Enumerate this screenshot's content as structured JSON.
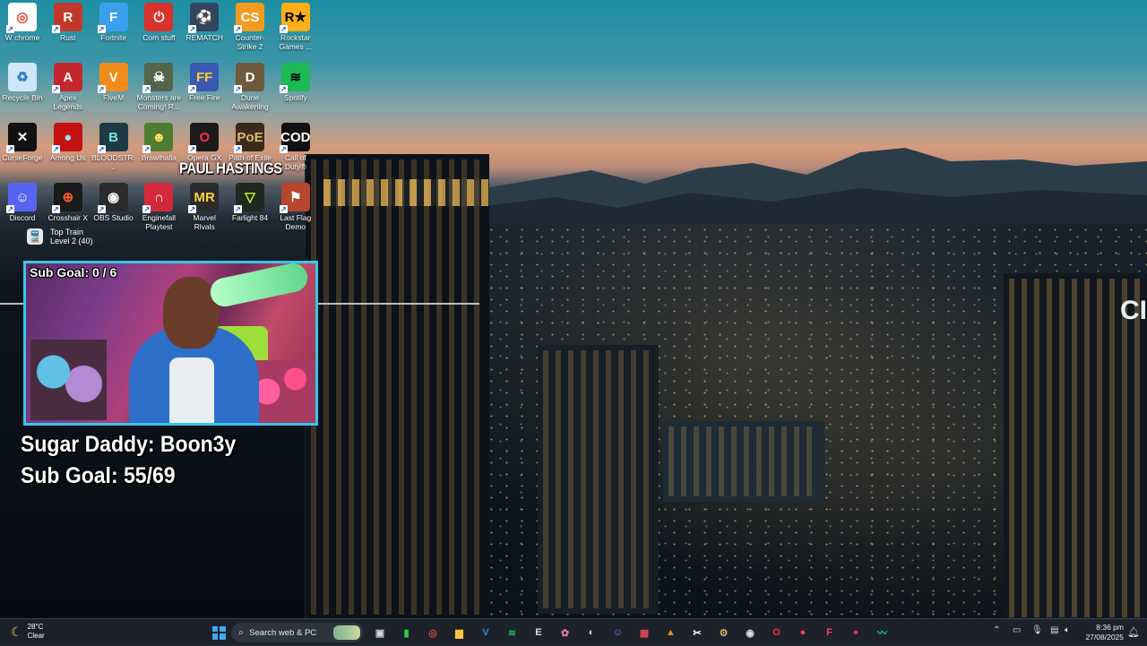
{
  "desktop_icons": [
    {
      "label": "W chrome",
      "glyph": "◎",
      "bg": "#ffffff",
      "fg": "#db4437",
      "col": 0,
      "row": 0
    },
    {
      "label": "Rust",
      "glyph": "R",
      "bg": "#c2392b",
      "fg": "#ffffff",
      "col": 1,
      "row": 0
    },
    {
      "label": "Fortnite",
      "glyph": "F",
      "bg": "#3aa0ee",
      "fg": "#ffffff",
      "col": 2,
      "row": 0
    },
    {
      "label": "Com stuff",
      "glyph": "⏻",
      "bg": "#d9322b",
      "fg": "#ffffff",
      "col": 3,
      "row": 0
    },
    {
      "label": "REMATCH",
      "glyph": "⚽",
      "bg": "#31465c",
      "fg": "#ffffff",
      "col": 4,
      "row": 0
    },
    {
      "label": "Counter-Strike 2",
      "glyph": "CS",
      "bg": "#f29b21",
      "fg": "#ffffff",
      "col": 5,
      "row": 0
    },
    {
      "label": "Rockstar Games ...",
      "glyph": "R★",
      "bg": "#fcaf17",
      "fg": "#000000",
      "col": 6,
      "row": 0
    },
    {
      "label": "Recycle Bin",
      "glyph": "♻",
      "bg": "#cfe6f7",
      "fg": "#2b7bc4",
      "col": 0,
      "row": 1
    },
    {
      "label": "Apex Legends",
      "glyph": "A",
      "bg": "#c4272d",
      "fg": "#ffffff",
      "col": 1,
      "row": 1
    },
    {
      "label": "FiveM",
      "glyph": "V",
      "bg": "#f08c1a",
      "fg": "#ffffff",
      "col": 2,
      "row": 1
    },
    {
      "label": "Monsters are Coming! R...",
      "glyph": "☠",
      "bg": "#54644a",
      "fg": "#ffffff",
      "col": 3,
      "row": 1
    },
    {
      "label": "Free Fire",
      "glyph": "FF",
      "bg": "#3a59b0",
      "fg": "#ffcc33",
      "col": 4,
      "row": 1
    },
    {
      "label": "Dune Awakening",
      "glyph": "D",
      "bg": "#6e5a3c",
      "fg": "#ffffff",
      "col": 5,
      "row": 1
    },
    {
      "label": "Spotify",
      "glyph": "≋",
      "bg": "#1db954",
      "fg": "#000000",
      "col": 6,
      "row": 1
    },
    {
      "label": "CurseForge",
      "glyph": "✕",
      "bg": "#121212",
      "fg": "#ffffff",
      "col": 0,
      "row": 2
    },
    {
      "label": "Among Us",
      "glyph": "●",
      "bg": "#c51111",
      "fg": "#9ddcf0",
      "col": 1,
      "row": 2
    },
    {
      "label": "BLOODSTR...",
      "glyph": "B",
      "bg": "#1d3b44",
      "fg": "#7fe0e0",
      "col": 2,
      "row": 2
    },
    {
      "label": "Brawlhalla",
      "glyph": "☻",
      "bg": "#4f7d2f",
      "fg": "#ffe25a",
      "col": 3,
      "row": 2
    },
    {
      "label": "Opera GX",
      "glyph": "O",
      "bg": "#1b1b1b",
      "fg": "#ff2b4a",
      "col": 4,
      "row": 2
    },
    {
      "label": "Path of Exile 2",
      "glyph": "PoE",
      "bg": "#3a2a1c",
      "fg": "#e3b873",
      "col": 5,
      "row": 2
    },
    {
      "label": "Call of Duty®",
      "glyph": "COD",
      "bg": "#111111",
      "fg": "#ffffff",
      "col": 6,
      "row": 2
    },
    {
      "label": "Discord",
      "glyph": "☺",
      "bg": "#5865f2",
      "fg": "#ffffff",
      "col": 0,
      "row": 3
    },
    {
      "label": "Crosshair X",
      "glyph": "⊕",
      "bg": "#1a1a1a",
      "fg": "#ff5a2a",
      "col": 1,
      "row": 3
    },
    {
      "label": "OBS Studio",
      "glyph": "◉",
      "bg": "#2b2b2b",
      "fg": "#ffffff",
      "col": 2,
      "row": 3
    },
    {
      "label": "Enginefall Playtest",
      "glyph": "∩",
      "bg": "#d22a3a",
      "fg": "#ffffff",
      "col": 3,
      "row": 3
    },
    {
      "label": "Marvel Rivals",
      "glyph": "MR",
      "bg": "#2b2b2b",
      "fg": "#ffd23a",
      "col": 4,
      "row": 3
    },
    {
      "label": "Farlight 84",
      "glyph": "▽",
      "bg": "#1f2a1e",
      "fg": "#c6ff2e",
      "col": 5,
      "row": 3
    },
    {
      "label": "Last Flag Demo",
      "glyph": "⚑",
      "bg": "#b7462e",
      "fg": "#ffffff",
      "col": 6,
      "row": 3
    }
  ],
  "top_train": {
    "line1": "Top Train",
    "line2": "Level 2 (40)"
  },
  "overlay": {
    "watermark": "PAUL HASTINGS",
    "cam_subgoal": "Sub Goal: 0 / 6",
    "line1": "Sugar Daddy: Boon3y",
    "line2": "Sub Goal: 55/69"
  },
  "scene": {
    "citi": "CI"
  },
  "taskbar": {
    "weather_temp": "28°C",
    "weather_cond": "Clear",
    "search_text": "Search web & PC",
    "apps": [
      {
        "name": "task-view",
        "glyph": "▣",
        "color": "#cfd6de"
      },
      {
        "name": "app-green",
        "glyph": "▮",
        "color": "#2ecc40"
      },
      {
        "name": "chrome",
        "glyph": "◎",
        "color": "#db4437"
      },
      {
        "name": "file-explorer",
        "glyph": "▆",
        "color": "#f5c542"
      },
      {
        "name": "vscode",
        "glyph": "V",
        "color": "#2f80d1"
      },
      {
        "name": "spotify",
        "glyph": "≋",
        "color": "#1db954"
      },
      {
        "name": "epic-games",
        "glyph": "E",
        "color": "#dddddd"
      },
      {
        "name": "app-pink",
        "glyph": "✿",
        "color": "#e87aa9"
      },
      {
        "name": "steam",
        "glyph": "◐",
        "color": "#cfd6de"
      },
      {
        "name": "discord",
        "glyph": "☺",
        "color": "#7b86f5"
      },
      {
        "name": "app-red-square",
        "glyph": "▦",
        "color": "#e0445a"
      },
      {
        "name": "vlc",
        "glyph": "▲",
        "color": "#f08c1a"
      },
      {
        "name": "capcut",
        "glyph": "✂",
        "color": "#ffffff"
      },
      {
        "name": "app-gear",
        "glyph": "⚙",
        "color": "#c8b46a"
      },
      {
        "name": "obs",
        "glyph": "◉",
        "color": "#dddddd"
      },
      {
        "name": "opera-gx",
        "glyph": "O",
        "color": "#ff2b4a"
      },
      {
        "name": "app-red",
        "glyph": "●",
        "color": "#ff4060"
      },
      {
        "name": "app-riot",
        "glyph": "F",
        "color": "#ff4060"
      },
      {
        "name": "app-red2",
        "glyph": "●",
        "color": "#e0304a"
      },
      {
        "name": "app-teal",
        "glyph": "〰",
        "color": "#19c7b5"
      }
    ],
    "time": "8:36 pm",
    "date": "27/08/2025"
  }
}
